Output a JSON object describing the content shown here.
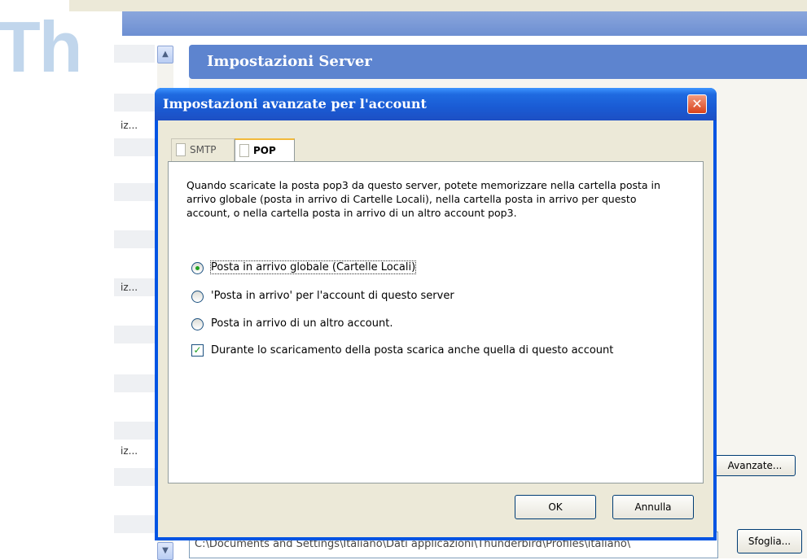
{
  "background": {
    "watermark_text": "Th",
    "panel_title": "Impostazioni Server",
    "list_truncated": [
      "iz...",
      "iz...",
      "iz..."
    ],
    "advanced_button": "Avanzate...",
    "browse_button": "Sfoglia...",
    "path_value": "C:\\Documents and Settings\\Italiano\\Dati applicazioni\\Thunderbird\\Profiles\\italiano\\"
  },
  "dialog": {
    "title": "Impostazioni avanzate per l'account",
    "close_glyph": "✕",
    "tabs": [
      {
        "label": "SMTP",
        "active": false
      },
      {
        "label": "POP",
        "active": true
      }
    ],
    "description": "Quando scaricate la posta pop3 da questo server, potete memorizzare nella cartella posta in arrivo globale (posta in arrivo di Cartelle Locali), nella cartella posta in arrivo per questo account, o nella cartella posta in arrivo di un altro account pop3.",
    "options": [
      {
        "type": "radio",
        "label": "Posta in arrivo globale (Cartelle Locali)",
        "checked": true
      },
      {
        "type": "radio",
        "label": "'Posta in arrivo' per l'account di questo server",
        "checked": false
      },
      {
        "type": "radio",
        "label": "Posta in arrivo di un altro account.",
        "checked": false
      },
      {
        "type": "checkbox",
        "label": "Durante lo scaricamento della posta scarica anche quella di questo account",
        "checked": true
      }
    ],
    "ok_label": "OK",
    "cancel_label": "Annulla"
  },
  "colors": {
    "titlebar": "#1f6ae0",
    "panel_header": "#5d84cf",
    "check_green": "#21a121",
    "close_red": "#d9421b"
  }
}
